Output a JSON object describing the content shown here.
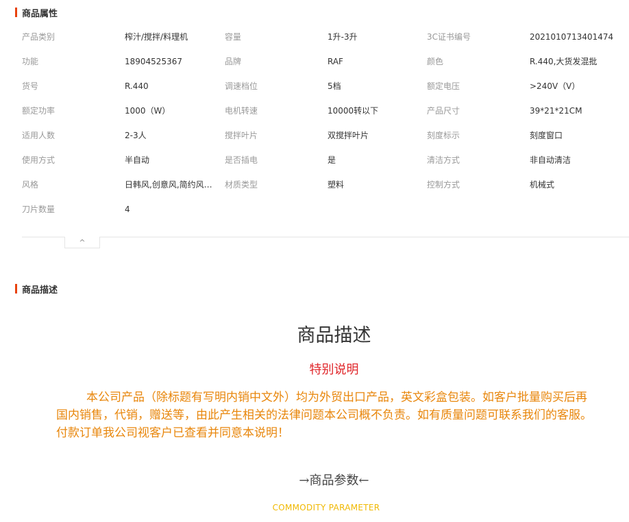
{
  "attributes_section": {
    "title": "商品属性",
    "rows": [
      [
        [
          "产品类别",
          "榨汁/搅拌/料理机"
        ],
        [
          "容量",
          "1升-3升"
        ],
        [
          "3C证书编号",
          "2021010713401474"
        ]
      ],
      [
        [
          "功能",
          "18904525367"
        ],
        [
          "品牌",
          "RAF"
        ],
        [
          "颜色",
          "R.440,大货发混批"
        ]
      ],
      [
        [
          "货号",
          "R.440"
        ],
        [
          "调速档位",
          "5档"
        ],
        [
          "额定电压",
          ">240V（V）"
        ]
      ],
      [
        [
          "额定功率",
          "1000（W）"
        ],
        [
          "电机转速",
          "10000转以下"
        ],
        [
          "产品尺寸",
          "39*21*21CM"
        ]
      ],
      [
        [
          "适用人数",
          "2-3人"
        ],
        [
          "搅拌叶片",
          "双搅拌叶片"
        ],
        [
          "刻度标示",
          "刻度窗口"
        ]
      ],
      [
        [
          "使用方式",
          "半自动"
        ],
        [
          "是否插电",
          "是"
        ],
        [
          "清洁方式",
          "非自动清洁"
        ]
      ],
      [
        [
          "风格",
          "日韩风,创意风,简约风,..."
        ],
        [
          "材质类型",
          "塑料"
        ],
        [
          "控制方式",
          "机械式"
        ]
      ],
      [
        [
          "刀片数量",
          "4"
        ]
      ]
    ],
    "collapse_icon": "chevron-up-icon",
    "collapse_glyph": "^"
  },
  "description_section": {
    "title": "商品描述",
    "heading": "商品描述",
    "special_title": "特别说明",
    "notice": "本公司产品（除标题有写明内销中文外）均为外贸出口产品，英文彩盒包装。如客户批量购买后再国内销售，代销，赠送等，由此产生相关的法律问题本公司概不负责。如有质量问题可联系我们的客服。付款订单我公司视客户已查看并同意本说明！",
    "param_heading": "→商品参数←",
    "param_sub": "COMMODITY  PARAMETER"
  },
  "colors": {
    "accent_bar": "#e8420e",
    "special_title": "#e0262a",
    "notice_text": "#e8860b",
    "param_sub": "#f0b800"
  }
}
